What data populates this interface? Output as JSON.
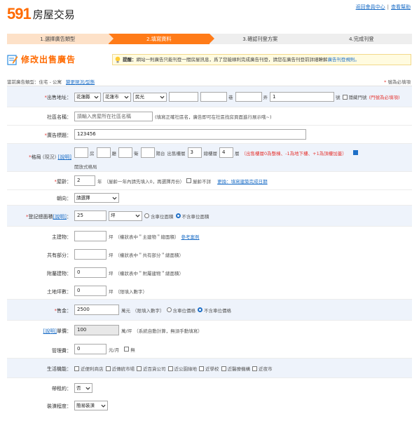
{
  "header": {
    "logo_num": "591",
    "logo_text": "房屋交易",
    "member_link": "返回會員中心",
    "help_link": "查看幫助"
  },
  "steps": [
    "1.選擇廣告類型",
    "2.填寫資料",
    "3.確認刊登方案",
    "4.完成刊登"
  ],
  "page_title": "修改出售廣告",
  "tip": {
    "label": "提醒：",
    "text": "網站一則廣告只能刊登一間房屋訊息，爲了您能順利完成廣告刊登，請您在廣告刊登前詳細瞭解",
    "link": "廣告刊登規則。"
  },
  "category": {
    "label": "當前廣告類型：住宅 - 公寓",
    "change": "變更現況/型態"
  },
  "required_note": {
    "star": "*",
    "text": "號為必填項"
  },
  "address": {
    "label": "出售地址：",
    "county": "花蓮縣",
    "city": "花蓮市",
    "district": "民光",
    "lane_unit": "巷",
    "alley_unit": "弄",
    "number": "1",
    "number_unit": "號",
    "hide_label": "隱藏門號",
    "hint": "(門號為必填項)"
  },
  "community": {
    "label": "社區名稱：",
    "placeholder": "請輸入房屋所在社區名稱",
    "hint": "(填寫正確社區名，廣告即可在社區找房頁面進行展示哦~)"
  },
  "ad_title": {
    "label": "廣告標題：",
    "value": "123456"
  },
  "layout": {
    "label": "格局",
    "label_note": "(現況)",
    "help": "[說明]",
    "room": "房",
    "hall": "廳",
    "bath": "衛",
    "balcony": "陽台",
    "floor_label": "出售樓層",
    "floor": "3",
    "total_label": "總樓層",
    "total": "4",
    "floor_unit": "層",
    "floor_hint": "（出售樓層0為整棟、-1為地下樓、+1為頂樓加蓋）",
    "open_label": "開放式格局"
  },
  "age": {
    "label": "屋齡：",
    "value": "2",
    "unit": "年",
    "hint": "（屋齡一年內請先填入0，再選擇月份）",
    "unknown": "屋齡不詳",
    "link": "更換：填寫建築完成日期"
  },
  "facing": {
    "label": "朝向：",
    "value": "請選擇"
  },
  "area": {
    "label": "登記總面積",
    "help": "[說明]",
    "value": "25",
    "unit": "坪",
    "opt_with": "含車位面積",
    "opt_without": "不含車位面積"
  },
  "main_building": {
    "label": "主建物：",
    "unit": "坪",
    "hint": "（權狀表中＂主建物＂總面積）",
    "link": "參考案例"
  },
  "common": {
    "label": "共有部分：",
    "unit": "坪",
    "hint": "（權狀表中＂共有部分＂總面積）"
  },
  "ancillary": {
    "label": "附屬建物：",
    "value": "0",
    "unit": "坪",
    "hint": "（權狀表中＂附屬建物＂總面積）"
  },
  "land": {
    "label": "土地坪數：",
    "value": "0",
    "unit": "坪",
    "hint": "（限填入數字）"
  },
  "price": {
    "label": "售金：",
    "value": "2500",
    "unit": "萬元",
    "hint": "（限填入數字）",
    "opt_with": "含車位價格",
    "opt_without": "不含車位價格"
  },
  "unit_price": {
    "label": "單價：",
    "help": "[說明]",
    "value": "100",
    "unit": "萬/坪",
    "hint": "（系統自動計算，無須手動填寫）"
  },
  "mgmt": {
    "label": "管理費：",
    "value": "0",
    "unit": "元/月",
    "none": "無"
  },
  "living": {
    "label": "生活機能：",
    "options": [
      "近便利商店",
      "近傳統市場",
      "近百貨公司",
      "近公園綠地",
      "近學校",
      "近醫療機構",
      "近夜市"
    ]
  },
  "lease": {
    "label": "帶租約：",
    "value": "否"
  },
  "decor": {
    "label": "裝潢程度：",
    "value": "簡易裝潢"
  }
}
